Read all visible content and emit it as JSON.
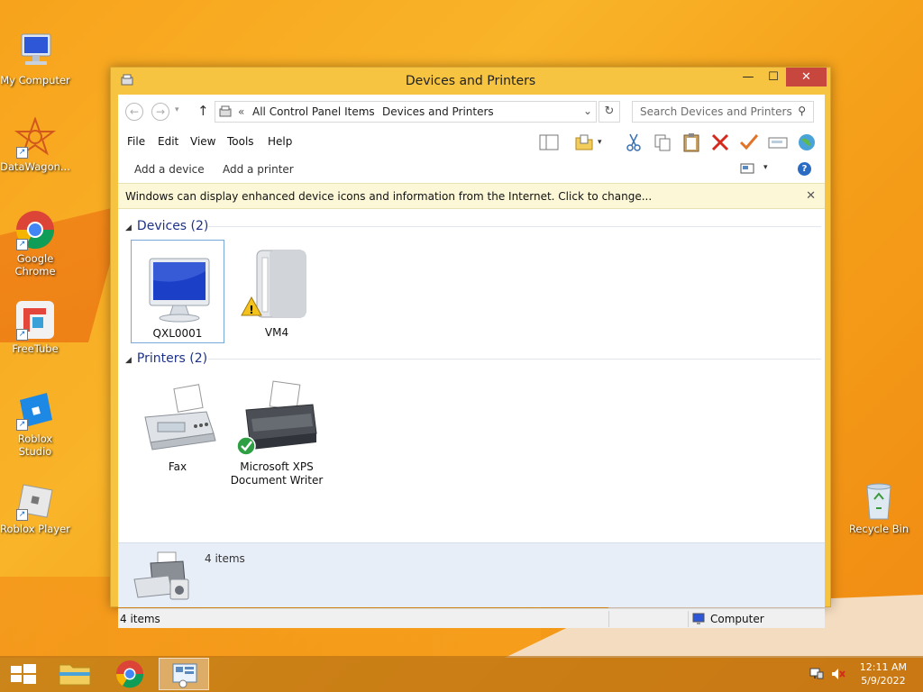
{
  "desktop": {
    "icons": [
      {
        "label": "My Computer"
      },
      {
        "label": "DataWagon..."
      },
      {
        "label": "Google Chrome"
      },
      {
        "label": "FreeTube"
      },
      {
        "label": "Roblox Studio"
      },
      {
        "label": "Roblox Player"
      },
      {
        "label": "Recycle Bin"
      }
    ]
  },
  "window": {
    "title": "Devices and Printers",
    "controls": {
      "minimize": "—",
      "maximize": "☐",
      "close": "✕"
    },
    "address": {
      "prefix": "«",
      "segments": [
        "All Control Panel Items",
        "Devices and Printers"
      ],
      "separator": "›"
    },
    "search_placeholder": "Search Devices and Printers",
    "menu": [
      "File",
      "Edit",
      "View",
      "Tools",
      "Help"
    ],
    "commands": {
      "add_device": "Add a device",
      "add_printer": "Add a printer"
    },
    "infobar": "Windows can display enhanced device icons and information from the Internet. Click to change...",
    "groups": {
      "devices": {
        "heading": "Devices (2)",
        "items": [
          {
            "label": "QXL0001"
          },
          {
            "label": "VM4"
          }
        ]
      },
      "printers": {
        "heading": "Printers (2)",
        "items": [
          {
            "label": "Fax"
          },
          {
            "label": "Microsoft XPS Document Writer"
          }
        ]
      }
    },
    "details": {
      "count": "4 items"
    },
    "status": {
      "left": "4 items",
      "right": "Computer"
    }
  },
  "taskbar": {
    "time": "12:11 AM",
    "date": "5/9/2022"
  },
  "colors": {
    "accent": "#f6c440",
    "close": "#c7463e",
    "heading": "#1e3287"
  }
}
